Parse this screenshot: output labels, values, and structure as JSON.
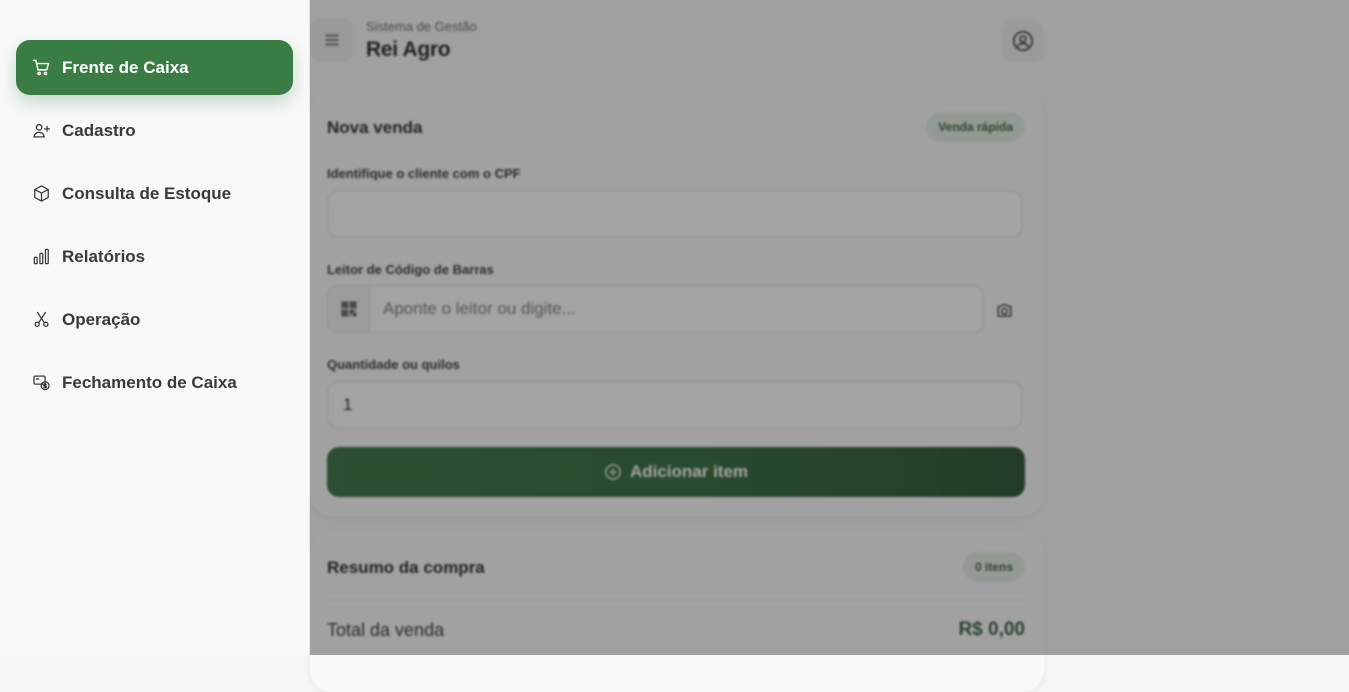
{
  "app": {
    "subtitle": "Sistema de Gestão",
    "title": "Rei Agro"
  },
  "sidebar": {
    "items": [
      {
        "label": "Frente de Caixa",
        "icon": "cart-icon",
        "active": true
      },
      {
        "label": "Cadastro",
        "icon": "user-plus-icon",
        "active": false
      },
      {
        "label": "Consulta de Estoque",
        "icon": "box-icon",
        "active": false
      },
      {
        "label": "Relatórios",
        "icon": "bar-chart-icon",
        "active": false
      },
      {
        "label": "Operação",
        "icon": "scissors-icon",
        "active": false
      },
      {
        "label": "Fechamento de Caixa",
        "icon": "cash-register-icon",
        "active": false
      }
    ]
  },
  "sale": {
    "title": "Nova venda",
    "badge": "Venda rápida",
    "cpf_label": "Identifique o cliente com o CPF",
    "cpf_value": "",
    "barcode_label": "Leitor de Código de Barras",
    "barcode_placeholder": "Aponte o leitor ou digite...",
    "quantity_label": "Quantidade ou quilos",
    "quantity_value": "1",
    "add_button": "Adicionar item"
  },
  "summary": {
    "title": "Resumo da compra",
    "items_badge": "0 itens",
    "total_label": "Total da venda",
    "total_value": "R$ 0,00"
  },
  "colors": {
    "accent": "#3a7d44",
    "accent_dark": "#1f4d28",
    "overlay": "rgba(40,40,40,0.42)"
  }
}
